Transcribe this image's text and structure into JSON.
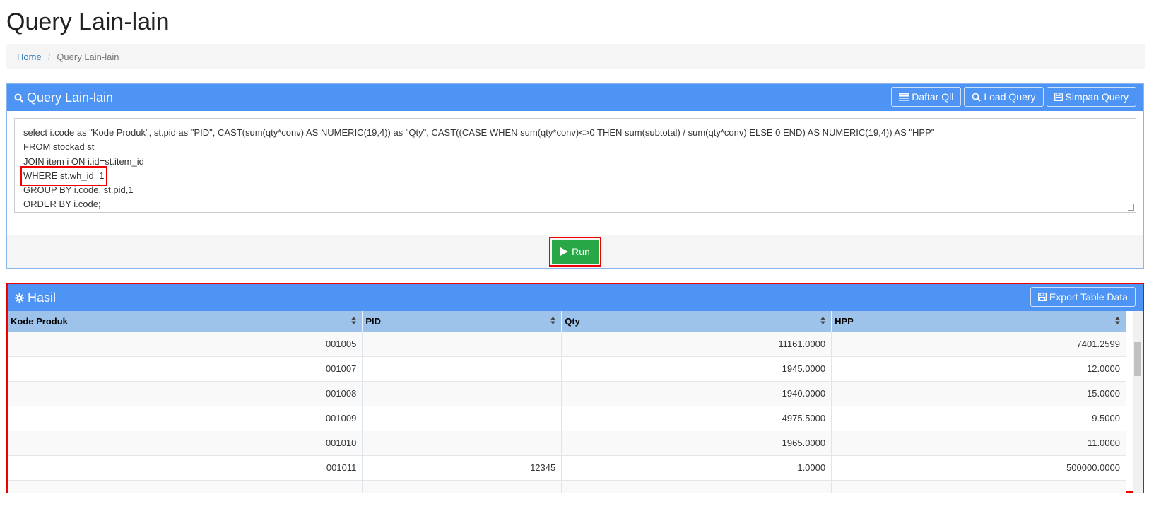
{
  "page_title": "Query Lain-lain",
  "breadcrumb": {
    "home": "Home",
    "current": "Query Lain-lain"
  },
  "query_panel": {
    "title": "Query Lain-lain",
    "icon": "search-icon",
    "buttons": {
      "daftar": "Daftar Qll",
      "load": "Load Query",
      "simpan": "Simpan Query"
    },
    "sql": {
      "line1": "select i.code as \"Kode Produk\", st.pid as \"PID\", CAST(sum(qty*conv) AS NUMERIC(19,4)) as \"Qty\", CAST((CASE WHEN sum(qty*conv)<>0 THEN sum(subtotal) / sum(qty*conv) ELSE 0 END) AS NUMERIC(19,4)) AS \"HPP\"",
      "line2": "FROM stockad st",
      "line3": "JOIN item i ON i.id=st.item_id",
      "line4": "WHERE st.wh_id=1",
      "line5": "GROUP BY i.code, st.pid,1",
      "line6": "ORDER BY i.code;"
    },
    "run_label": "Run"
  },
  "result_panel": {
    "title": "Hasil",
    "icon": "gear-icon",
    "export_label": "Export Table Data",
    "columns": [
      "Kode Produk",
      "PID",
      "Qty",
      "HPP"
    ],
    "rows": [
      [
        "001005",
        "",
        "11161.0000",
        "7401.2599"
      ],
      [
        "001007",
        "",
        "1945.0000",
        "12.0000"
      ],
      [
        "001008",
        "",
        "1940.0000",
        "15.0000"
      ],
      [
        "001009",
        "",
        "4975.5000",
        "9.5000"
      ],
      [
        "001010",
        "",
        "1965.0000",
        "11.0000"
      ],
      [
        "001011",
        "12345",
        "1.0000",
        "500000.0000"
      ]
    ]
  },
  "colors": {
    "panel_header": "#4d94f5",
    "table_header": "#9dc3ea",
    "run_button": "#28a745",
    "highlight": "#ee0000"
  }
}
